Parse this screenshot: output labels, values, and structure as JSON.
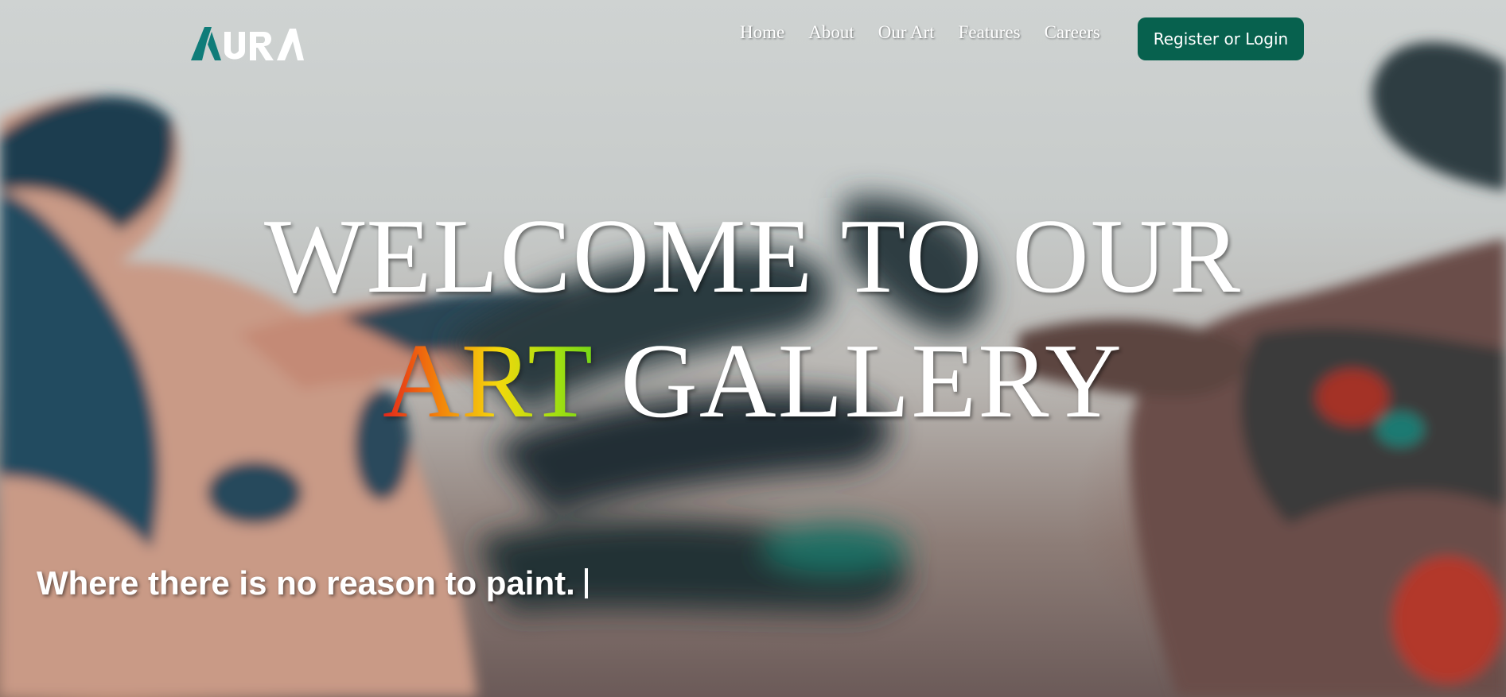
{
  "brand": {
    "logo_text": "AURA",
    "accent_color": "#07614e",
    "logo_teal": "#0f7c79"
  },
  "nav": {
    "items": [
      {
        "label": "Home"
      },
      {
        "label": "About"
      },
      {
        "label": "Our Art"
      },
      {
        "label": "Features"
      },
      {
        "label": "Careers"
      }
    ],
    "cta_label": "Register or Login"
  },
  "hero": {
    "headline_line1": "WELCOME TO OUR",
    "headline_art": "ART",
    "headline_gallery": "GALLERY",
    "tagline": "Where there is no reason to paint.",
    "background_image": "paint-covered-hands-photo"
  }
}
